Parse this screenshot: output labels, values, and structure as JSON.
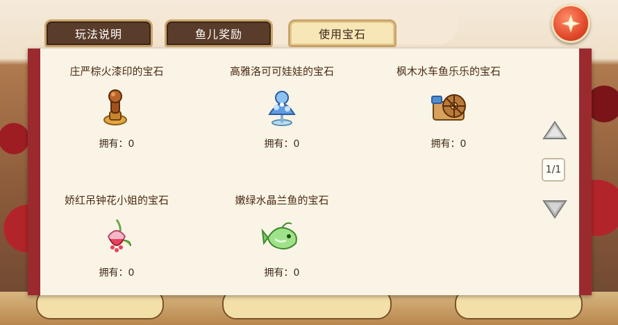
{
  "tabs": [
    {
      "label": "玩法说明",
      "active": false
    },
    {
      "label": "鱼儿奖励",
      "active": false
    },
    {
      "label": "使用宝石",
      "active": true
    }
  ],
  "gems": [
    {
      "name": "庄严棕火漆印的宝石",
      "count_text": "拥有：0",
      "icon": "wax-seal-icon"
    },
    {
      "name": "高雅洛可可娃娃的宝石",
      "count_text": "拥有：0",
      "icon": "rococo-doll-icon"
    },
    {
      "name": "枫木水车鱼乐乐的宝石",
      "count_text": "拥有：0",
      "icon": "waterwheel-icon"
    },
    {
      "name": "娇红吊钟花小姐的宝石",
      "count_text": "拥有：0",
      "icon": "fuchsia-flower-icon"
    },
    {
      "name": "嫩绿水晶兰鱼的宝石",
      "count_text": "拥有：0",
      "icon": "crystal-orchid-fish-icon"
    }
  ],
  "pager": {
    "text": "1/1"
  },
  "colors": {
    "panel_border": "#9b2a2e",
    "panel_bg": "#faf4e6",
    "close_button": "#e24a2c"
  }
}
